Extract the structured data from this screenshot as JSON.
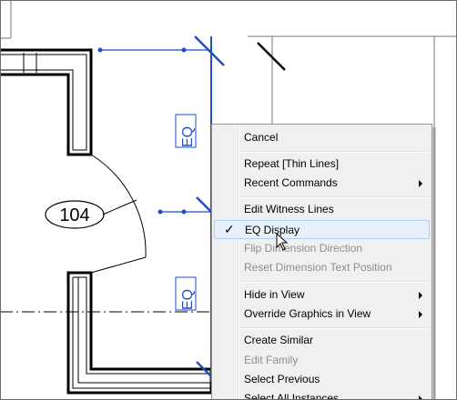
{
  "tag_label": "104",
  "eq_labels": [
    "EQ",
    "EQ"
  ],
  "colors": {
    "dimension": "#1e4fc8",
    "wall": "#000000",
    "menu_bg": "#f0f0f0",
    "hover_bg": "#e8f1fb",
    "disabled_text": "#8d8d8d"
  },
  "context_menu": {
    "items": [
      {
        "label": "Cancel"
      },
      {
        "label": "Repeat [Thin Lines]"
      },
      {
        "label": "Recent Commands",
        "submenu": true
      },
      {
        "label": "Edit Witness Lines"
      },
      {
        "label": "EQ Display",
        "checked": true,
        "hovered": true
      },
      {
        "label": "Flip Dimension Direction",
        "disabled": true
      },
      {
        "label": "Reset Dimension Text Position",
        "disabled": true
      },
      {
        "label": "Hide in View",
        "submenu": true
      },
      {
        "label": "Override Graphics in View",
        "submenu": true
      },
      {
        "label": "Create Similar"
      },
      {
        "label": "Edit Family",
        "disabled": true
      },
      {
        "label": "Select Previous"
      },
      {
        "label": "Select All Instances",
        "submenu": true
      }
    ],
    "check_glyph": "✓"
  }
}
